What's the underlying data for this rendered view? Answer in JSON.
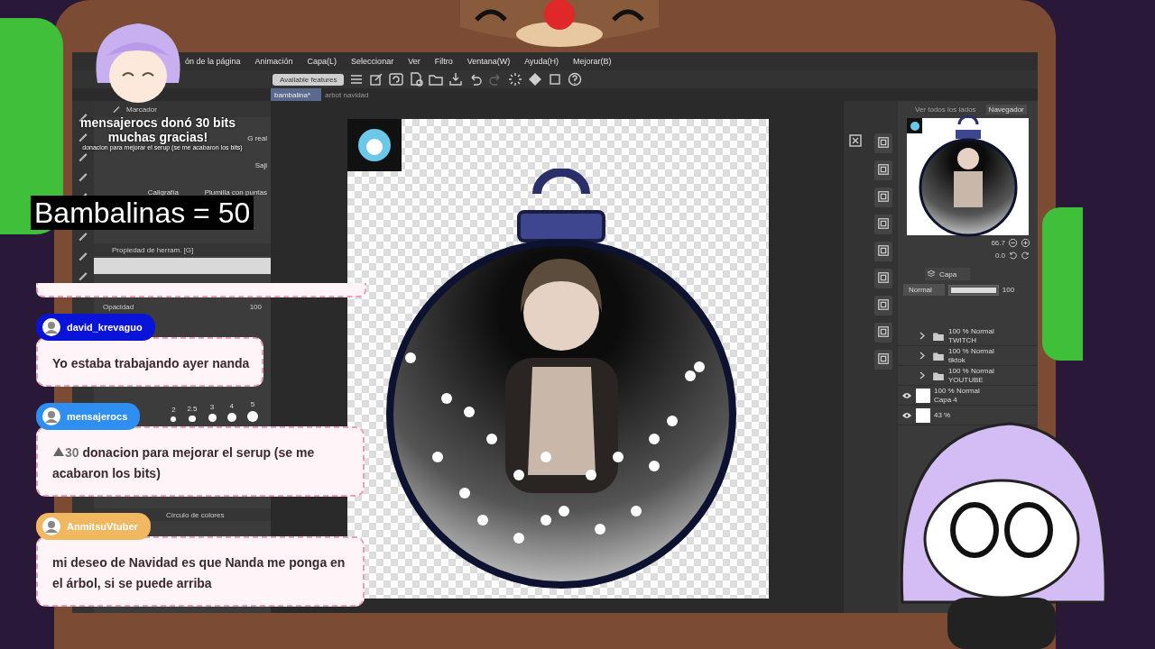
{
  "menu": [
    "ón de la página",
    "Animación",
    "Capa(L)",
    "Seleccionar",
    "Ver",
    "Filtro",
    "Ventana(W)",
    "Ayuda(H)",
    "Mejorar(B)"
  ],
  "toolbar": {
    "features_button": "Available features"
  },
  "tabs": [
    {
      "label": "bambalina*",
      "selected": true
    },
    {
      "label": "arbot navidad",
      "selected": false
    }
  ],
  "brush_panel": {
    "title": "Marcador",
    "brushes": [
      "G real",
      "Saji",
      "Caligrafía",
      "Plumilla con puntas"
    ]
  },
  "tool_property": {
    "title": "Propiedad de herram. [G]",
    "opacity_label": "Opacidad",
    "opacity_value": "100"
  },
  "brush_sizes": [
    "2",
    "2.5",
    "3",
    "4",
    "5"
  ],
  "color_panel": {
    "title": "Círculo de colores"
  },
  "navigator": {
    "tabs": [
      {
        "label": "Ver todos los lados",
        "selected": false
      },
      {
        "label": "Navegador",
        "selected": true
      }
    ],
    "zoom": "66.7",
    "angle": "0.0"
  },
  "layers": {
    "tab": "Capa",
    "blend_mode": "Normal",
    "opacity_slider": {
      "level": 1
    },
    "opacity": "100",
    "items": [
      {
        "kind": "folder",
        "mode": "100 % Normal",
        "name": "TWITCH",
        "visible": false
      },
      {
        "kind": "folder",
        "mode": "100 % Normal",
        "name": "tiktok",
        "visible": false
      },
      {
        "kind": "folder",
        "mode": "100 % Normal",
        "name": "YOUTUBE",
        "visible": false
      },
      {
        "kind": "layer",
        "mode": "100 % Normal",
        "name": "Capa 4",
        "visible": true
      },
      {
        "kind": "layer",
        "mode": "43 %",
        "visible": true
      }
    ]
  },
  "alert": {
    "user": "mensajerocs",
    "action": "donó",
    "amount": "30 bits",
    "thanks": "muchas gracias!",
    "message": "donacion para mejorar el serup (se me acabaron los bits)"
  },
  "counter": "Bambalinas = 50",
  "chat": [
    {
      "user": "david_krevaguo",
      "color": "#0a14d8",
      "text": "Yo estaba trabajando ayer nanda"
    },
    {
      "user": "mensajerocs",
      "color": "#2e8ff0",
      "bits": "30",
      "text": "donacion para mejorar el serup (se me acabaron los bits)"
    },
    {
      "user": "AnmitsuVtuber",
      "color": "#f0b860",
      "text": "mi deseo de Navidad es que Nanda me ponga en el árbol, si se puede arriba"
    }
  ]
}
